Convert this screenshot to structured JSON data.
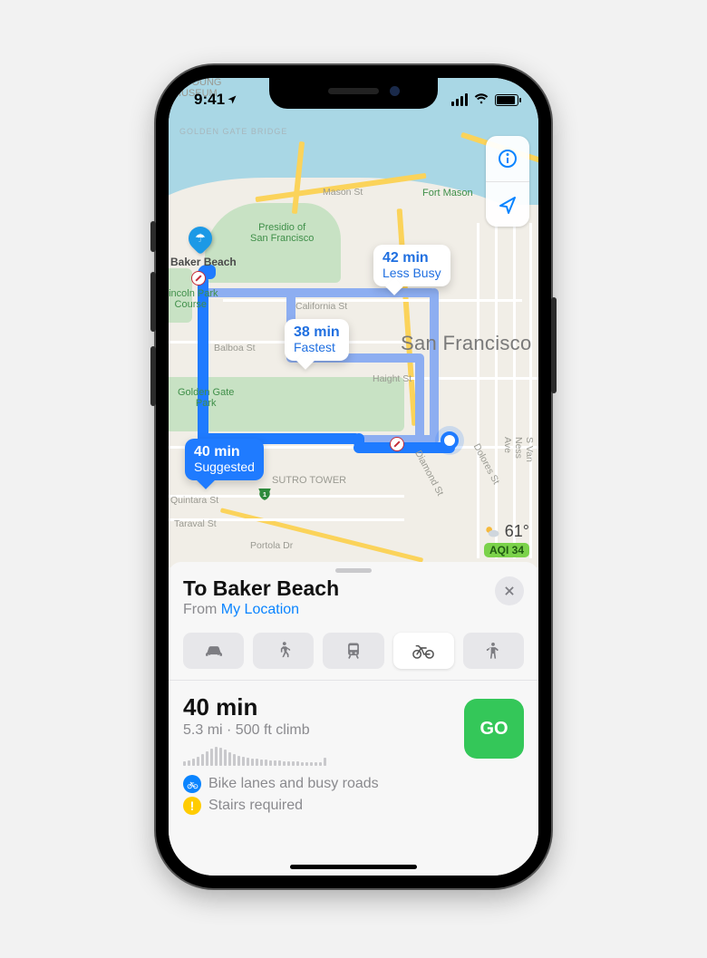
{
  "status": {
    "time": "9:41"
  },
  "map": {
    "destination_label": "Baker Beach",
    "city_label": "San Francisco",
    "labels": {
      "presidio": "Presidio of\nSan Francisco",
      "ggp": "Golden Gate\nPark",
      "lincoln": "Lincoln Park\nCourse",
      "fort_mason": "Fort Mason",
      "bridge": "GOLDEN GATE\nBRIDGE",
      "sutro": "SUTRO TOWER",
      "deyoung": "DE YOUNG\nMUSEUM"
    },
    "streets": {
      "mason": "Mason St",
      "california": "California St",
      "balboa": "Balboa St",
      "haight": "Haight St",
      "quintara": "Quintara St",
      "taraval": "Taraval St",
      "portola": "Portola Dr",
      "dolores": "Dolores St",
      "diamond": "Diamond St",
      "noe": "S Van Ness Ave"
    },
    "callouts": [
      {
        "time": "42 min",
        "sub": "Less Busy"
      },
      {
        "time": "38 min",
        "sub": "Fastest"
      },
      {
        "time": "40 min",
        "sub": "Suggested"
      }
    ],
    "weather": {
      "temp": "61°",
      "aqi": "AQI 34"
    },
    "shield": "1"
  },
  "sheet": {
    "title": "To Baker Beach",
    "from_label": "From ",
    "from_link": "My Location",
    "modes": [
      "car",
      "walk",
      "transit",
      "bike",
      "rideshare"
    ],
    "active_mode": "bike",
    "route": {
      "duration": "40 min",
      "distance": "5.3 mi",
      "sep": " · ",
      "climb": "500 ft climb",
      "advisories": [
        {
          "icon": "bike",
          "text": "Bike lanes and busy roads"
        },
        {
          "icon": "warn",
          "text": "Stairs required"
        }
      ],
      "go": "GO"
    }
  }
}
